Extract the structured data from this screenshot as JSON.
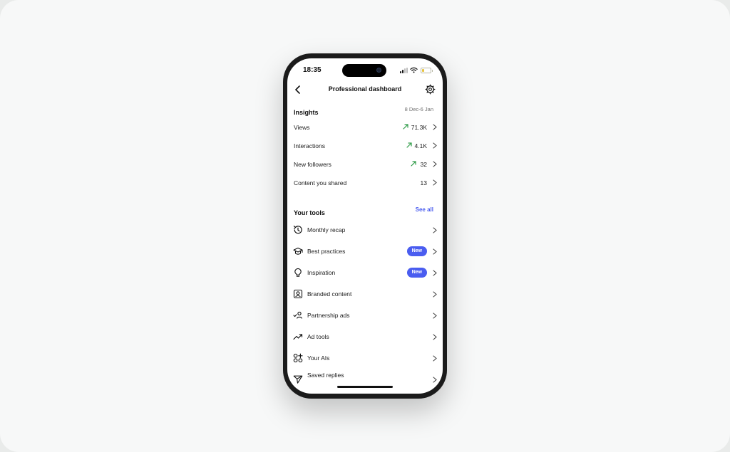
{
  "status": {
    "time": "18:35"
  },
  "nav": {
    "title": "Professional dashboard"
  },
  "insights": {
    "title": "Insights",
    "range": "8 Dec-6 Jan",
    "rows": [
      {
        "label": "Views",
        "value": "71.3K",
        "trend": "up"
      },
      {
        "label": "Interactions",
        "value": "4.1K",
        "trend": "up"
      },
      {
        "label": "New followers",
        "value": "32",
        "trend": "up"
      },
      {
        "label": "Content you shared",
        "value": "13",
        "trend": "none"
      }
    ]
  },
  "tools": {
    "title": "Your tools",
    "see_all": "See all",
    "items": [
      {
        "label": "Monthly recap",
        "icon": "history-icon",
        "badge": ""
      },
      {
        "label": "Best practices",
        "icon": "graduation-cap-icon",
        "badge": "New"
      },
      {
        "label": "Inspiration",
        "icon": "lightbulb-icon",
        "badge": "New"
      },
      {
        "label": "Branded content",
        "icon": "branded-content-icon",
        "badge": ""
      },
      {
        "label": "Partnership ads",
        "icon": "partnership-icon",
        "badge": ""
      },
      {
        "label": "Ad tools",
        "icon": "trending-up-icon",
        "badge": ""
      },
      {
        "label": "Your AIs",
        "icon": "shapes-icon",
        "badge": ""
      },
      {
        "label": "Saved replies",
        "icon": "send-icon",
        "badge": ""
      }
    ]
  },
  "colors": {
    "accent": "#4a5df0",
    "trend_up": "#2e9b47",
    "background": "#f7f8f8"
  }
}
